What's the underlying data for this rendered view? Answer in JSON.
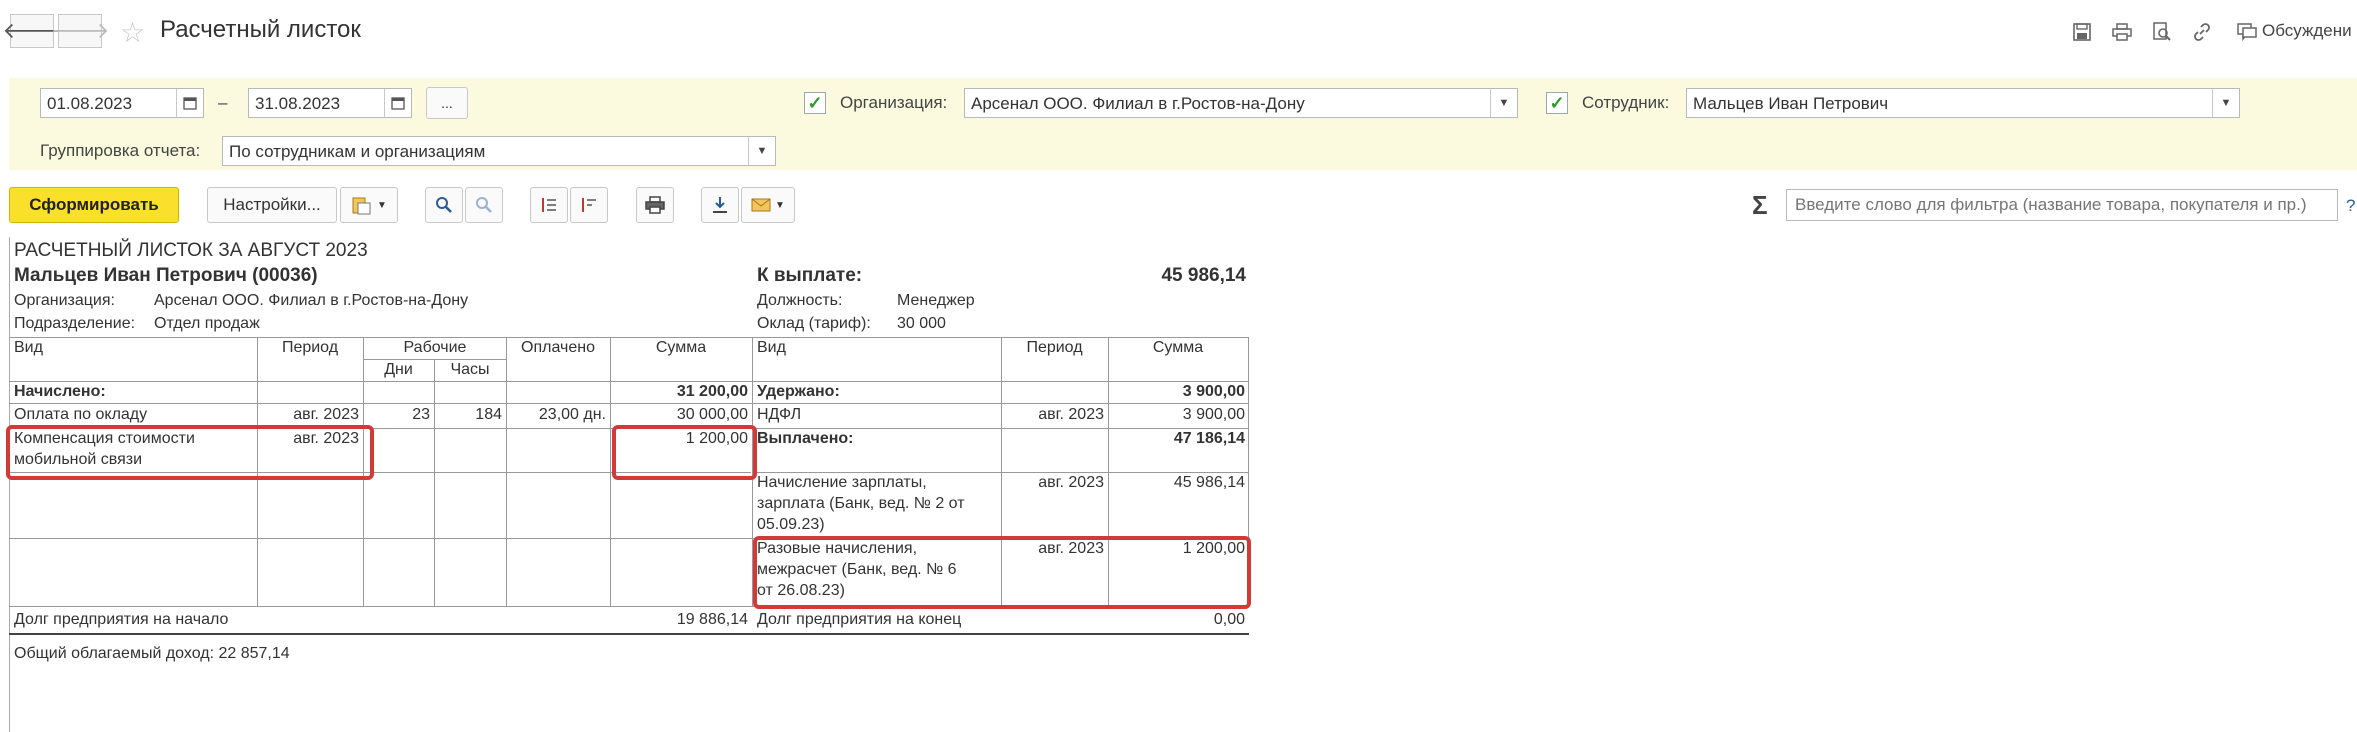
{
  "header": {
    "title": "Расчетный листок",
    "discussions": "Обсуждени"
  },
  "filters": {
    "date_from": "01.08.2023",
    "date_sep": "–",
    "date_to": "31.08.2023",
    "more": "...",
    "org_label": "Организация:",
    "org_value": "Арсенал ООО. Филиал в г.Ростов-на-Дону",
    "emp_label": "Сотрудник:",
    "emp_value": "Мальцев Иван Петрович",
    "group_label": "Группировка отчета:",
    "group_value": "По сотрудникам и организациям"
  },
  "toolbar": {
    "generate": "Сформировать",
    "settings": "Настройки...",
    "sigma": "Σ",
    "search_placeholder": "Введите слово для фильтра (название товара, покупателя и пр.)",
    "help": "?"
  },
  "report": {
    "title": "РАСЧЕТНЫЙ ЛИСТОК ЗА АВГУСТ 2023",
    "employee": "Мальцев Иван Петрович (00036)",
    "org_label": "Организация:",
    "org_value": "Арсенал ООО. Филиал в г.Ростов-на-Дону",
    "dept_label": "Подразделение:",
    "dept_value": "Отдел продаж",
    "to_pay_label": "К выплате:",
    "to_pay_value": "45 986,14",
    "position_label": "Должность:",
    "position_value": "Менеджер",
    "rate_label": "Оклад (тариф):",
    "rate_value": "30 000",
    "left_headers": {
      "kind": "Вид",
      "period": "Период",
      "working": "Рабочие",
      "days": "Дни",
      "hours": "Часы",
      "paid": "Оплачено",
      "sum": "Сумма"
    },
    "right_headers": {
      "kind": "Вид",
      "period": "Период",
      "sum": "Сумма"
    },
    "accrued_label": "Начислено:",
    "accrued_total": "31 200,00",
    "accruals": [
      {
        "kind": "Оплата по окладу",
        "period": "авг. 2023",
        "days": "23",
        "hours": "184",
        "paid": "23,00 дн.",
        "sum": "30 000,00"
      },
      {
        "kind1": "Компенсация стоимости",
        "kind2": "мобильной связи",
        "period": "авг. 2023",
        "sum": "1 200,00"
      }
    ],
    "withheld_label": "Удержано:",
    "withheld_total": "3 900,00",
    "withholdings": [
      {
        "kind": "НДФЛ",
        "period": "авг. 2023",
        "sum": "3 900,00"
      }
    ],
    "paid_out_label": "Выплачено:",
    "paid_out_total": "47 186,14",
    "payments": [
      {
        "l1": "Начисление зарплаты,",
        "l2": "зарплата (Банк, вед. № 2 от",
        "l3": "05.09.23)",
        "period": "авг. 2023",
        "sum": "45 986,14"
      },
      {
        "l1": "Разовые начисления,",
        "l2": "межрасчет (Банк, вед. № 6",
        "l3": "от 26.08.23)",
        "period": "авг. 2023",
        "sum": "1 200,00"
      }
    ],
    "debt_start_label": "Долг предприятия на начало",
    "debt_start_value": "19 886,14",
    "debt_end_label": "Долг предприятия на конец",
    "debt_end_value": "0,00",
    "taxable_income": "Общий облагаемый доход: 22 857,14"
  }
}
